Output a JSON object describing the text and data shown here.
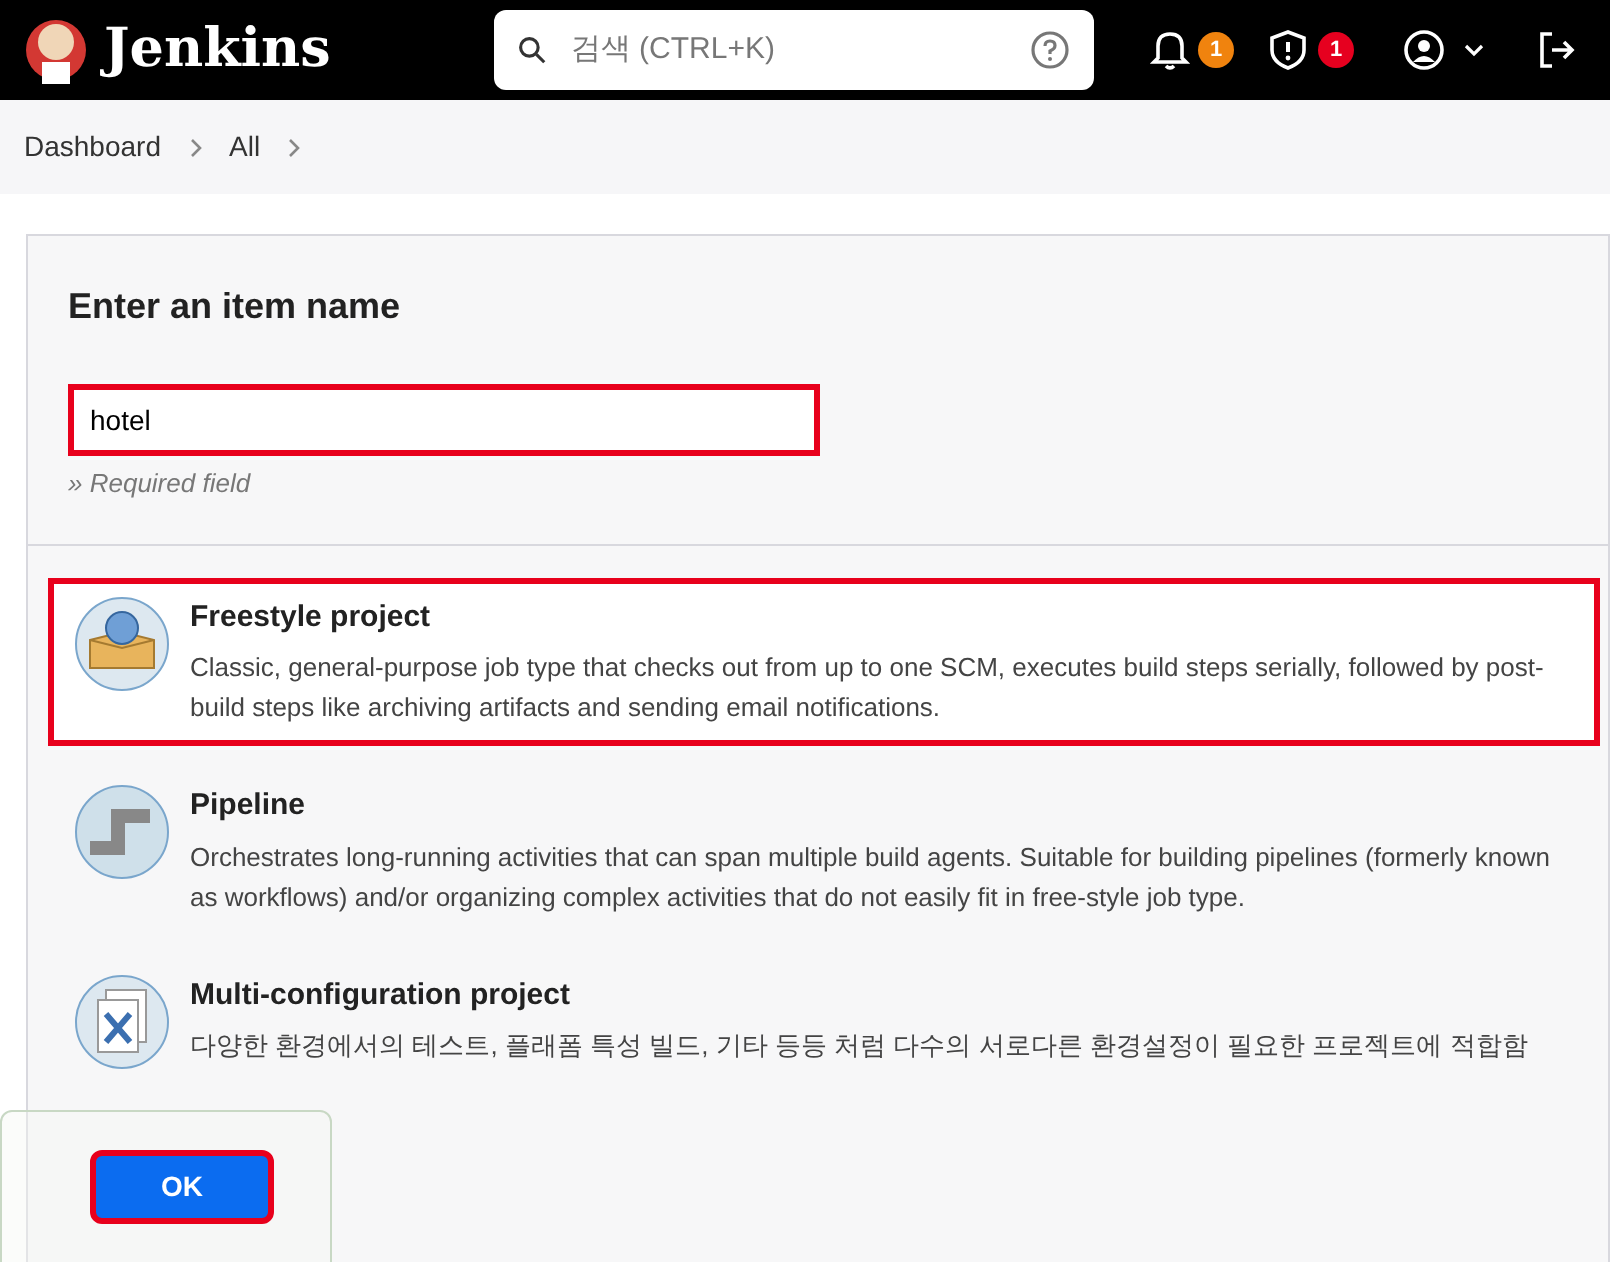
{
  "header": {
    "brand": "Jenkins",
    "search": {
      "placeholder": "검색 (CTRL+K)"
    },
    "notifications": {
      "count": "1",
      "color": "#f0830e"
    },
    "security": {
      "count": "1",
      "color": "#e6001f"
    }
  },
  "breadcrumbs": [
    "Dashboard",
    "All"
  ],
  "form": {
    "title": "Enter an item name",
    "name_field": {
      "value": "hotel",
      "annotated": true
    },
    "hint": "» Required field"
  },
  "items": [
    {
      "kind": "freestyle",
      "title": "Freestyle project",
      "description": "Classic, general-purpose job type that checks out from up to one SCM, executes build steps serially, followed by post-build steps like archiving artifacts and sending email notifications.",
      "selected": true
    },
    {
      "kind": "pipeline",
      "title": "Pipeline",
      "description": "Orchestrates long-running activities that can span multiple build agents. Suitable for building pipelines (formerly known as workflows) and/or organizing complex activities that do not easily fit in free-style job type.",
      "selected": false
    },
    {
      "kind": "multi",
      "title": "Multi-configuration project",
      "description": "다양한 환경에서의 테스트, 플래폼 특성 빌드, 기타 등등 처럼 다수의 서로다른 환경설정이 필요한 프로젝트에 적합함",
      "selected": false
    }
  ],
  "ok_button": {
    "label": "OK",
    "annotated": true
  }
}
